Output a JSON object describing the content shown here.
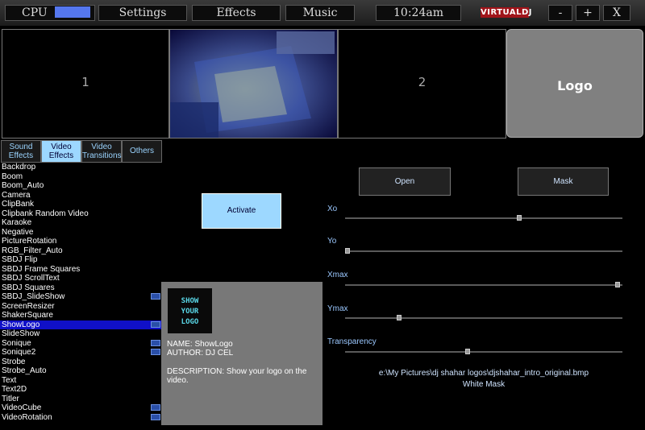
{
  "topbar": {
    "cpu_label": "CPU",
    "settings_label": "Settings",
    "effects_label": "Effects",
    "music_label": "Music",
    "clock": "10:24am",
    "brand": "VIRTUALDJ",
    "minimize_label": "-",
    "maximize_label": "+",
    "close_label": "X",
    "cpu_color": "#5577ee"
  },
  "previews": {
    "deck1_label": "1",
    "deck2_label": "2",
    "logo_label": "Logo"
  },
  "tabs": [
    {
      "line1": "Sound",
      "line2": "Effects"
    },
    {
      "line1": "Video",
      "line2": "Effects"
    },
    {
      "line1": "Video",
      "line2": "Transitions"
    },
    {
      "line1": "Others",
      "line2": ""
    }
  ],
  "effects": [
    {
      "name": "Backdrop"
    },
    {
      "name": "Boom"
    },
    {
      "name": "Boom_Auto"
    },
    {
      "name": "Camera"
    },
    {
      "name": "ClipBank"
    },
    {
      "name": "Clipbank Random Video"
    },
    {
      "name": "Karaoke"
    },
    {
      "name": "Negative"
    },
    {
      "name": "PictureRotation"
    },
    {
      "name": "RGB_Filter_Auto"
    },
    {
      "name": "SBDJ Flip"
    },
    {
      "name": "SBDJ Frame Squares"
    },
    {
      "name": "SBDJ ScrollText"
    },
    {
      "name": "SBDJ Squares"
    },
    {
      "name": "SBDJ_SlideShow"
    },
    {
      "name": "ScreenResizer"
    },
    {
      "name": "ShakerSquare"
    },
    {
      "name": "ShowLogo"
    },
    {
      "name": "SlideShow"
    },
    {
      "name": "Sonique"
    },
    {
      "name": "Sonique2"
    },
    {
      "name": "Strobe"
    },
    {
      "name": "Strobe_Auto"
    },
    {
      "name": "Text"
    },
    {
      "name": "Text2D"
    },
    {
      "name": "Titler"
    },
    {
      "name": "VideoCube"
    },
    {
      "name": "VideoRotation"
    }
  ],
  "selected_effect": "ShowLogo",
  "info": {
    "thumb_text": "SHOW YOUR LOGO",
    "name_line": "NAME: ShowLogo",
    "author_line": "AUTHOR: DJ CEL",
    "description_line": "DESCRIPTION: Show your logo on the video."
  },
  "controls": {
    "activate_label": "Activate",
    "open_label": "Open",
    "mask_label": "Mask",
    "sliders": [
      {
        "label": "Xo",
        "value": 0.63
      },
      {
        "label": "Yo",
        "value": 0.0
      },
      {
        "label": "Xmax",
        "value": 0.99
      },
      {
        "label": "Ymax",
        "value": 0.19
      },
      {
        "label": "Transparency",
        "value": 0.44
      }
    ],
    "file_path": "e:\\My Pictures\\dj shahar logos\\djshahar_intro_original.bmp",
    "mask_text": "White Mask"
  }
}
